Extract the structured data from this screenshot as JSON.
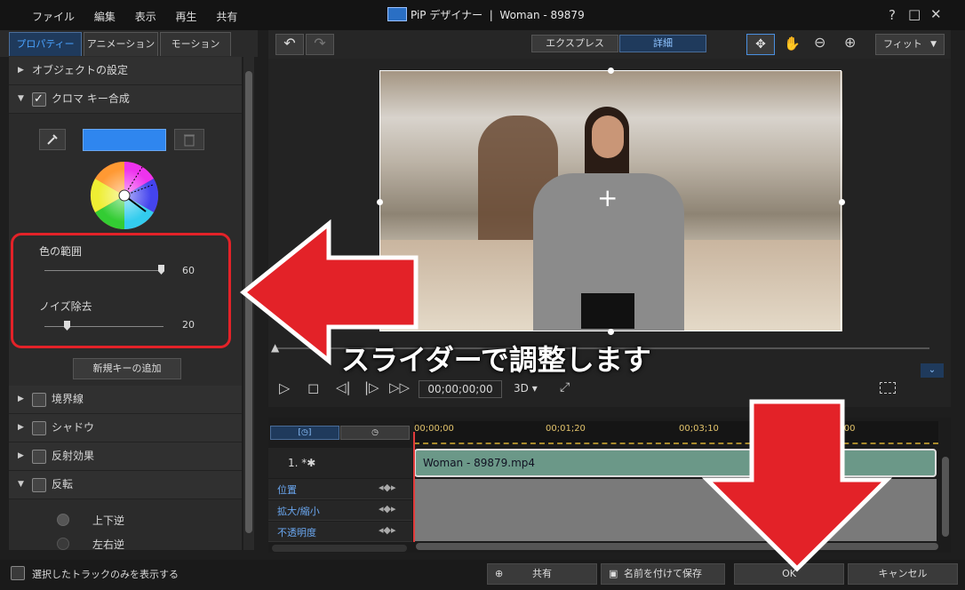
{
  "window": {
    "menu": [
      "ファイル",
      "編集",
      "表示",
      "再生",
      "共有"
    ],
    "title": "PiP デザイナー  |  Woman - 89879",
    "controls": [
      "?",
      "□",
      "✕"
    ]
  },
  "tabs": [
    "プロパティー",
    "アニメーション",
    "モーション"
  ],
  "sections": {
    "object_settings": "オブジェクトの設定",
    "chroma_key": "クロマ キー合成",
    "border": "境界線",
    "shadow": "シャドウ",
    "reflection": "反射効果",
    "flip": "反転"
  },
  "chroma": {
    "key_color": "#2f86ef",
    "color_range_label": "色の範囲",
    "color_range_value": "60",
    "noise_label": "ノイズ除去",
    "noise_value": "20",
    "add_key_button": "新規キーの追加"
  },
  "flip": {
    "vertical": "上下逆",
    "horizontal": "左右逆"
  },
  "toolbar": {
    "express": "エクスプレス",
    "detail": "詳細",
    "fit": "フィット"
  },
  "playback": {
    "timecode": "00;00;00;00",
    "mode": "3D"
  },
  "annotation": {
    "caption": "スライダーで調整します"
  },
  "timeline": {
    "ruler": [
      "00;00;00",
      "00;01;20",
      "00;03;10",
      "5;00"
    ],
    "track_label": "1. *✱",
    "clip_name": "Woman - 89879.mp4",
    "rows": [
      "位置",
      "拡大/縮小",
      "不透明度"
    ]
  },
  "footer": {
    "show_selected_only": "選択したトラックのみを表示する",
    "share": "共有",
    "save_as": "名前を付けて保存",
    "ok": "OK",
    "cancel": "キャンセル"
  }
}
